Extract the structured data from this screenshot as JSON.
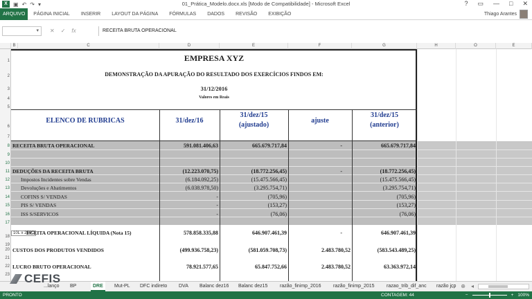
{
  "window": {
    "title": "01_Prática_Modelo.docx.xls  [Modo de Compatibilidade] - Microsoft Excel",
    "controls": [
      "?",
      "▭",
      "—",
      "□",
      "✕"
    ]
  },
  "ribbon": {
    "file_tab": "ARQUIVO",
    "tabs": [
      "PÁGINA INICIAL",
      "INSERIR",
      "LAYOUT DA PÁGINA",
      "FÓRMULAS",
      "DADOS",
      "REVISÃO",
      "EXIBIÇÃO"
    ],
    "user_name": "Thiago Arantes"
  },
  "formula_bar": {
    "name_box": "",
    "cancel": "✕",
    "enter": "✓",
    "fx": "fx",
    "content": "RECEITA BRUTA OPERACIONAL"
  },
  "columns": [
    "B",
    "C",
    "D",
    "E",
    "F",
    "G",
    "H",
    "O",
    "E"
  ],
  "rows": [
    "1",
    "2",
    "3",
    "4",
    "5",
    "6",
    "7",
    "8",
    "9",
    "10",
    "11",
    "12",
    "13",
    "14",
    "15",
    "16",
    "17",
    "18",
    "19",
    "20",
    "21",
    "22",
    "23"
  ],
  "report": {
    "company": "EMPRESA XYZ",
    "subtitle": "DEMONSTRAÇÃO DA APURAÇÃO DO RESULTADO DOS EXERCÍCIOS FINDOS EM:",
    "date": "31/12/2016",
    "units": "Valores em Reais",
    "headers": {
      "rubric": "ELENCO DE RUBRICAS",
      "col1": "31/dez/16",
      "col2_line1": "31/dez/15",
      "col2_line2": "(ajustado)",
      "col3": "ajuste",
      "col4_line1": "31/dez/15",
      "col4_line2": "(anterior)"
    },
    "lines": [
      {
        "label": "RECEITA BRUTA OPERACIONAL",
        "v1": "591.081.406,63",
        "v2": "665.679.717,84",
        "v3": "-",
        "v4": "665.679.717,84"
      },
      {
        "label": "DEDUÇÕES DA RECEITA BRUTA",
        "v1": "(12.223.070,75)",
        "v2": "(18.772.256,45)",
        "v3": "-",
        "v4": "(18.772.256,45)"
      },
      {
        "label": "Impostos Incidentes sobre Vendas",
        "v1": "(6.184.092,25)",
        "v2": "(15.475.566,45)",
        "v3": "",
        "v4": "(15.475.566,45)"
      },
      {
        "label": "Devoluções e Abatimentos",
        "v1": "(6.038.978,50)",
        "v2": "(3.295.754,71)",
        "v3": "",
        "v4": "(3.295.754,71)"
      },
      {
        "label": "COFINS S/ VENDAS",
        "v1": "-",
        "v2": "(705,96)",
        "v3": "",
        "v4": "(705,96)"
      },
      {
        "label": "PIS S/ VENDAS",
        "v1": "-",
        "v2": "(153,27)",
        "v3": "",
        "v4": "(153,27)"
      },
      {
        "label": "ISS S/SERVICOS",
        "v1": "-",
        "v2": "(76,06)",
        "v3": "",
        "v4": "(76,06)"
      },
      {
        "label": "ECEITA  OPERACIONAL LÍQUIDA (Nota 15)",
        "v1": "578.858.335,88",
        "v2": "646.907.461,39",
        "v3": "-",
        "v4": "646.907.461,39"
      },
      {
        "label": "CUSTOS DOS PRODUTOS VENDIDOS",
        "v1": "(499.936.758,23)",
        "v2": "(581.059.708,73)",
        "v3": "2.483.780,52",
        "v4": "(583.543.489,25)"
      },
      {
        "label": "LUCRO BRUTO OPERACIONAL",
        "v1": "78.921.577,65",
        "v2": "65.847.752,66",
        "v3": "2.483.780,52",
        "v4": "63.363.972,14"
      }
    ],
    "selection_size": "10L x 256C"
  },
  "sheet_tabs": [
    "DRE",
    "Mut-PL",
    "DFC indireto",
    "DVA",
    "Balanc dez16",
    "Balanc dez15",
    "razão_finimp_2016",
    "razão_finimp_2015",
    "razao_trib_dif_anc",
    "razão jcp"
  ],
  "sheet_tabs_partial": [
    "...lanço",
    "BP"
  ],
  "active_sheet": "DRE",
  "status": {
    "ready": "PRONTO",
    "count": "CONTAGEM: 44",
    "zoom": "100%"
  },
  "watermark": "CEFIS"
}
